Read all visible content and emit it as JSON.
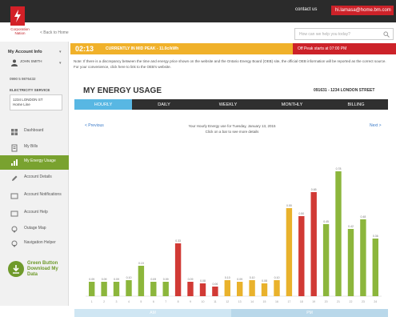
{
  "header": {
    "contact_label": "contact us",
    "email_label": "hi.lamasa@home.bm.com",
    "logo_text": "Corporation Nation",
    "back_label": "< Back to Home",
    "search_placeholder": "How can we help you today?"
  },
  "sidebar": {
    "account_heading": "My Account Info",
    "user_name": "JOHN SMITH",
    "account_number": "0990 5 9876432",
    "electricity_label": "ELECTRICITY SERVICE",
    "address": "1234 LONDON ST",
    "address_sub": "Home Line",
    "nav": [
      {
        "label": "Dashboard",
        "icon": "grid-icon",
        "active": false
      },
      {
        "label": "My Bills",
        "icon": "bill-icon",
        "active": false
      },
      {
        "label": "My Energy Usage",
        "icon": "chart-icon",
        "active": true
      },
      {
        "label": "Account Details",
        "icon": "pencil-icon",
        "active": false
      },
      {
        "label": "Account Notifications",
        "icon": "bell-icon",
        "active": false
      },
      {
        "label": "Account Help",
        "icon": "help-icon",
        "active": false
      },
      {
        "label": "Outage Map",
        "icon": "map-pin-icon",
        "active": false
      },
      {
        "label": "Navigation Helper",
        "icon": "pin-icon",
        "active": false
      }
    ],
    "green_button": "Green Button Download My Data"
  },
  "status": {
    "time": "02:13",
    "text": "CURRENTLY IN MID PEAK - 11.0c/kWh",
    "offpeak": "Off Peak starts at 07:00 PM"
  },
  "notice": "Note: If there is a discrepancy between the time and energy price shown on the website and the Ontario Energy Board (OEB) site, the official OEB information will be reported as the correct source. For your convenience, click here to link to the OEB's website.",
  "usage": {
    "title": "MY ENERGY USAGE",
    "meter": "091631 - 1234 LONDON STREET",
    "tabs": [
      "HOURLY",
      "DAILY",
      "WEEKLY",
      "MONTHLY",
      "BILLING"
    ],
    "active_tab": 0,
    "prev_label": "< Previous",
    "next_label": "Next >",
    "caption_line1": "Your Hourly Energy use for Tuesday, January 13, 2015",
    "caption_line2": "Click on a bar to see more details",
    "strip_left": "AM",
    "strip_right": "PM"
  },
  "colors": {
    "off_peak": "#8cb63c",
    "mid_peak": "#e9b22c",
    "on_peak": "#d13a35",
    "accent_blue": "#58b7e3",
    "brand_red": "#cc2229"
  },
  "chart_data": {
    "type": "bar",
    "categories": [
      "1",
      "2",
      "3",
      "4",
      "5",
      "6",
      "7",
      "8",
      "9",
      "10",
      "11",
      "12",
      "13",
      "14",
      "15",
      "16",
      "17",
      "18",
      "19",
      "20",
      "21",
      "22",
      "23",
      "24"
    ],
    "values": [
      0.09,
      0.09,
      0.09,
      0.1,
      0.19,
      0.09,
      0.09,
      0.33,
      0.09,
      0.08,
      0.06,
      0.1,
      0.09,
      0.1,
      0.08,
      0.1,
      0.55,
      0.5,
      0.65,
      0.45,
      0.78,
      0.42,
      0.48,
      0.36
    ],
    "periods": [
      "off",
      "off",
      "off",
      "off",
      "off",
      "off",
      "off",
      "on",
      "on",
      "on",
      "on",
      "mid",
      "mid",
      "mid",
      "mid",
      "mid",
      "mid",
      "on",
      "on",
      "off",
      "off",
      "off",
      "off",
      "off"
    ],
    "ylim": [
      0,
      0.9
    ],
    "grid": false
  }
}
